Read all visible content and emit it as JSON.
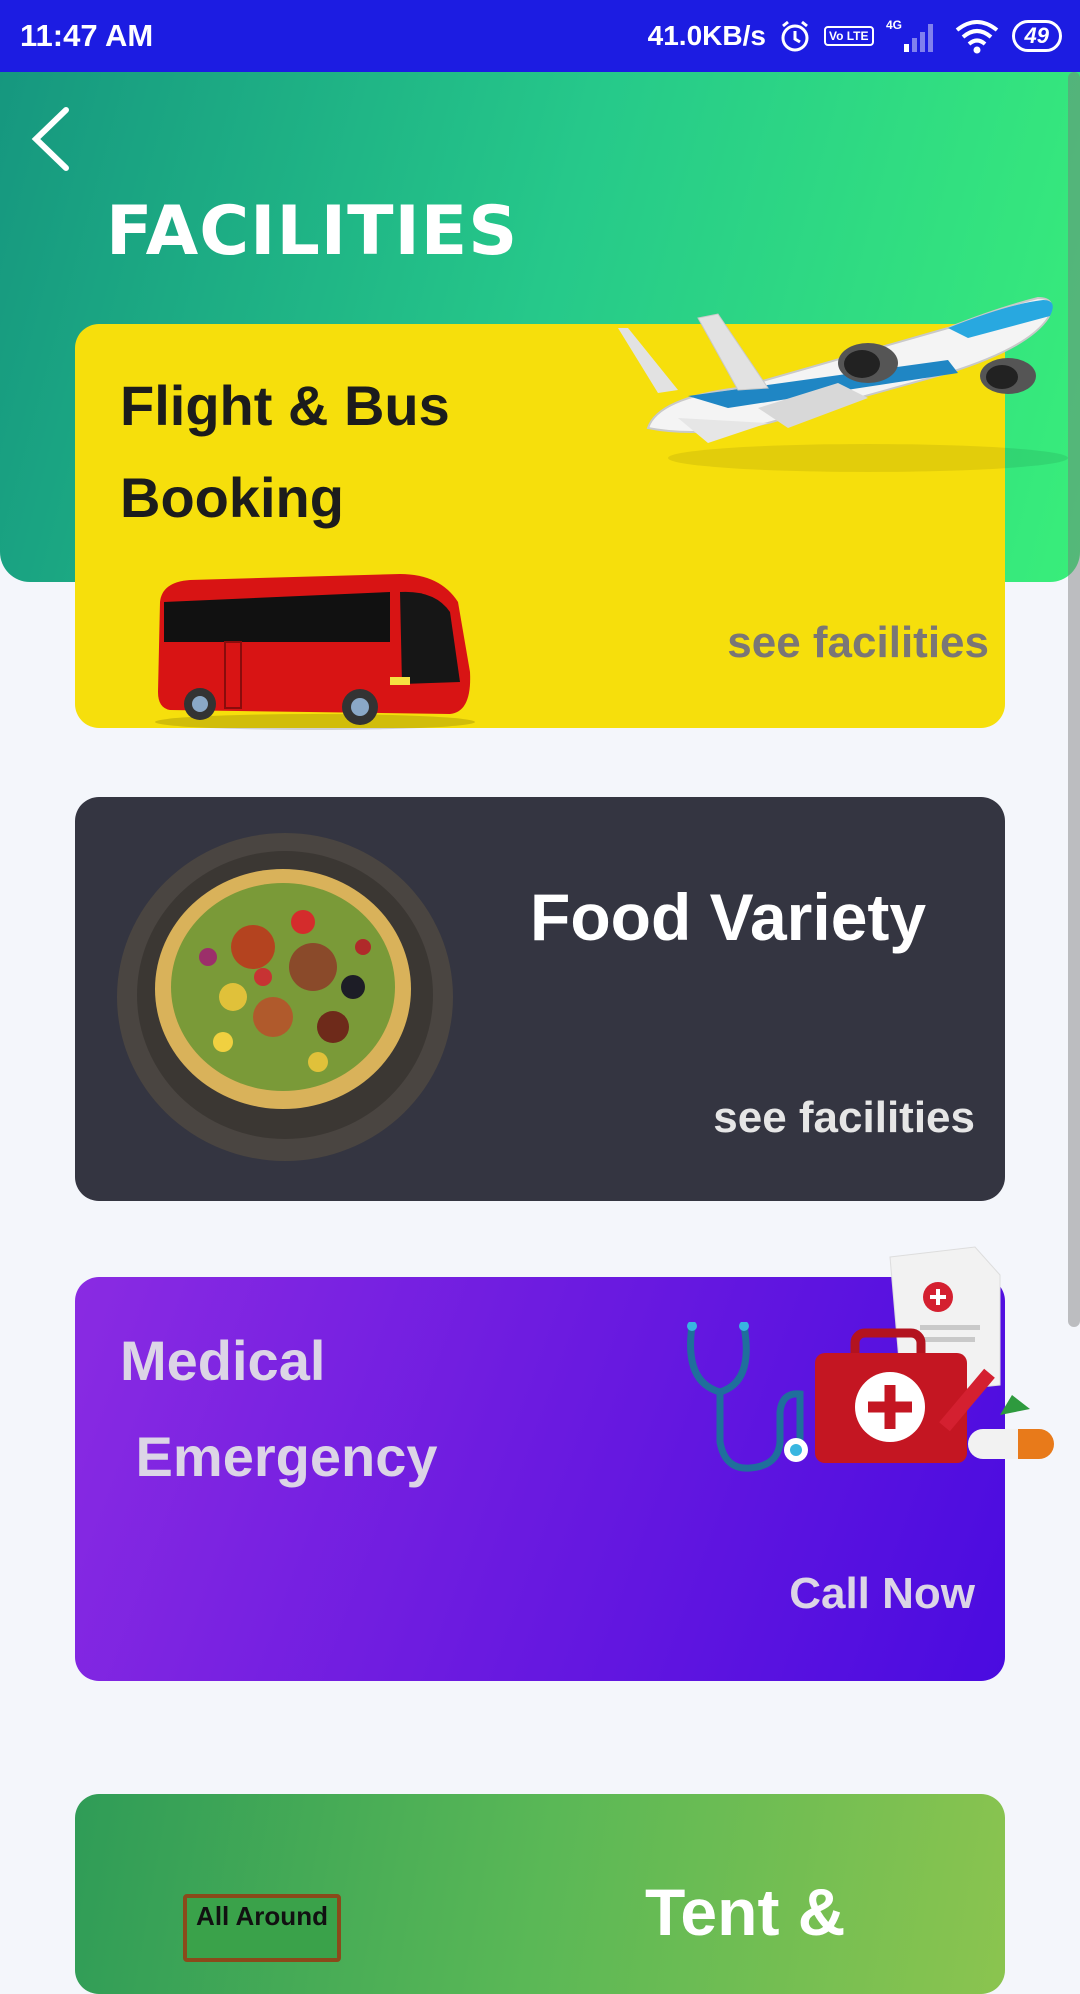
{
  "status_bar": {
    "time": "11:47 AM",
    "speed": "41.0KB/s",
    "volte": "Vo LTE",
    "network": "4G",
    "battery": "49"
  },
  "header": {
    "title": "FACILITIES"
  },
  "cards": {
    "flight": {
      "title": "Flight & Bus Booking",
      "action": "see  facilities",
      "color": "#f6df0c"
    },
    "food": {
      "title": "Food Variety",
      "action": "see  facilities",
      "color": "#343541"
    },
    "medical": {
      "title": "Medical\n Emergency",
      "action": "Call Now",
      "color": "#6a1ae0"
    },
    "tent": {
      "title": "Tent &",
      "sign": "All Around"
    }
  },
  "icons": [
    "back-arrow-icon",
    "alarm-icon",
    "signal-icon",
    "wifi-icon",
    "battery-icon",
    "airplane-icon",
    "bus-icon",
    "food-plate-icon",
    "stethoscope-icon",
    "medical-kit-icon"
  ]
}
